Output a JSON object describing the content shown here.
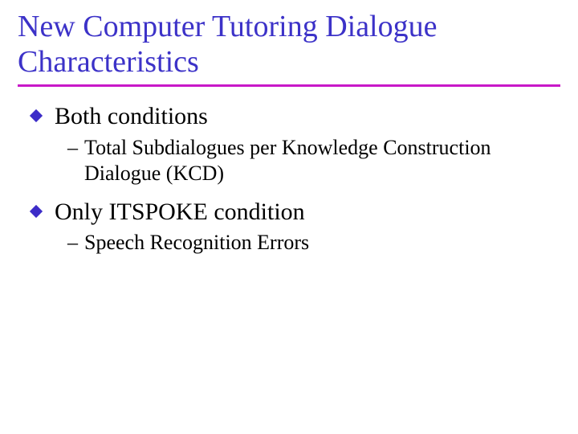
{
  "title": "New Computer Tutoring Dialogue Characteristics",
  "items": [
    {
      "label": "Both conditions",
      "sub": [
        "Total Subdialogues per Knowledge Construction Dialogue (KCD)"
      ]
    },
    {
      "label": "Only ITSPOKE condition",
      "sub": [
        "Speech Recognition Errors"
      ]
    }
  ],
  "colors": {
    "title": "#3c32c8",
    "rule": "#c818c8",
    "bullet": "#3c2cc8"
  }
}
